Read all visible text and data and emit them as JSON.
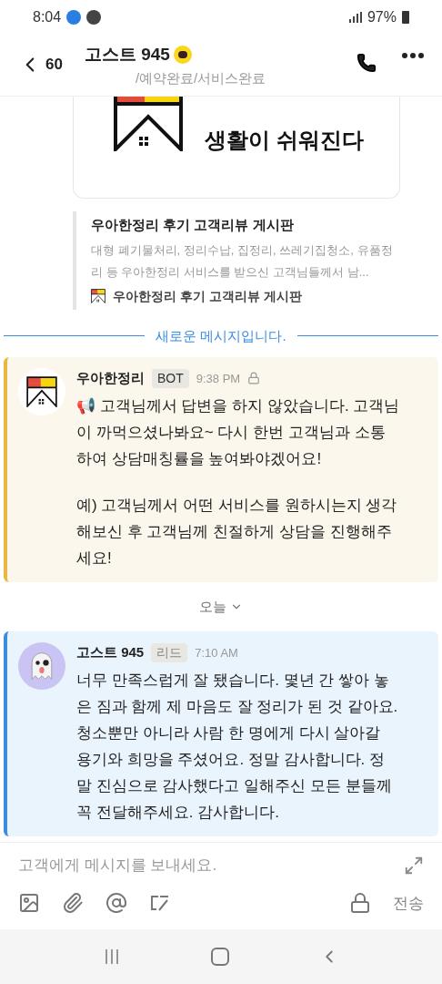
{
  "status_bar": {
    "time": "8:04",
    "battery": "97%"
  },
  "header": {
    "back_count": "60",
    "title": "고스트 945",
    "subtitle": "/예약완료/서비스완료"
  },
  "image_card": {
    "tagline": "생활이 쉬워진다"
  },
  "link_preview": {
    "title": "우아한정리 후기 고객리뷰 게시판",
    "description": "대형 폐기물처리, 정리수납, 집정리, 쓰레기집청소, 유품정리 등 우아한정리 서비스를 받으신 고객님들께서 남...",
    "source": "우아한정리 후기 고객리뷰 게시판"
  },
  "new_divider": "새로운 메시지입니다.",
  "messages": [
    {
      "kind": "bot",
      "sender": "우아한정리",
      "badge": "BOT",
      "time": "9:38 PM",
      "locked": true,
      "paragraphs": [
        "📢 고객님께서 답변을 하지 않았습니다. 고객님이 까먹으셨나봐요~ 다시 한번 고객님과 소통하여 상담매칭률을 높여봐야겠어요!",
        "예) 고객님께서 어떤 서비스를 원하시는지 생각해보신 후 고객님께 친절하게 상담을 진행해주세요!"
      ]
    },
    {
      "kind": "date",
      "label": "오늘"
    },
    {
      "kind": "user",
      "sender": "고스트 945",
      "badge": "리드",
      "time": "7:10 AM",
      "locked": false,
      "paragraphs": [
        "너무 만족스럽게 잘 됐습니다. 몇년 간 쌓아 놓은 짐과 함께 제 마음도 잘 정리가 된 것 같아요. 청소뿐만 아니라 사람 한 명에게 다시 살아갈 용기와 희망을 주셨어요. 정말 감사합니다. 정말 진심으로 감사했다고 일해주신 모든 분들께 꼭 전달해주세요. 감사합니다."
      ]
    }
  ],
  "composer": {
    "placeholder": "고객에게 메시지를 보내세요.",
    "send": "전송"
  }
}
